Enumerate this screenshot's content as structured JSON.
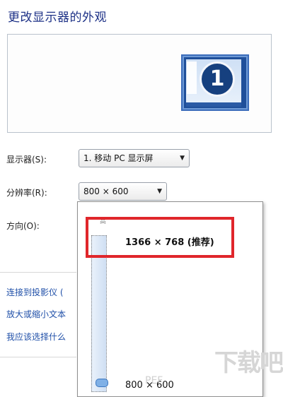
{
  "window": {
    "title": "更改显示器的外观"
  },
  "preview": {
    "monitor_number": "1"
  },
  "display": {
    "label": "显示器(S):",
    "value": "1. 移动 PC 显示屏"
  },
  "resolution": {
    "label": "分辨率(R):",
    "value": "800 × 600",
    "slider_top_label": "高",
    "options": {
      "highest": "1366 × 768 (推荐)",
      "lowest": "800 × 600"
    },
    "slider_level_percent": 0
  },
  "orientation": {
    "label": "方向(O):"
  },
  "links": [
    {
      "label": "连接到投影仪 ("
    },
    {
      "label": "放大或缩小文本"
    },
    {
      "label": "我应该选择什么"
    }
  ],
  "watermark": {
    "text": "下载吧",
    "small": "PEF"
  },
  "colors": {
    "title": "#1e3287",
    "link": "#1f4fa8",
    "highlight": "#e0262b"
  }
}
